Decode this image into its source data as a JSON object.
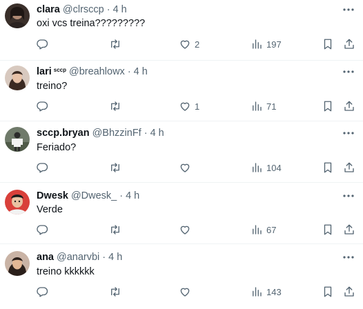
{
  "feed": {
    "tweets": [
      {
        "name": "clara",
        "badge": "",
        "handle": "@clrsccp",
        "time": "4 h",
        "text": "oxi vcs treina?????????",
        "likes": "2",
        "views": "197"
      },
      {
        "name": "lari",
        "badge": "sccp",
        "handle": "@breahlowx",
        "time": "4 h",
        "text": "treino?",
        "likes": "1",
        "views": "71"
      },
      {
        "name": "sccp.bryan",
        "badge": "",
        "handle": "@BhzzinFf",
        "time": "4 h",
        "text": "Feriado?",
        "likes": "",
        "views": "104"
      },
      {
        "name": "Dwesk",
        "badge": "",
        "handle": "@Dwesk_",
        "time": "4 h",
        "text": "Verde",
        "likes": "",
        "views": "67"
      },
      {
        "name": "ana",
        "badge": "",
        "handle": "@anarvbi",
        "time": "4 h",
        "text": "treino kkkkkk",
        "likes": "",
        "views": "143"
      }
    ],
    "separator": "·"
  },
  "icons": {
    "reply": "reply-icon",
    "retweet": "retweet-icon",
    "like": "heart-icon",
    "views": "views-icon",
    "bookmark": "bookmark-icon",
    "share": "share-icon",
    "more": "more-icon"
  },
  "colors": {
    "text": "#0f1419",
    "muted": "#536471",
    "divider": "#eff3f4"
  }
}
